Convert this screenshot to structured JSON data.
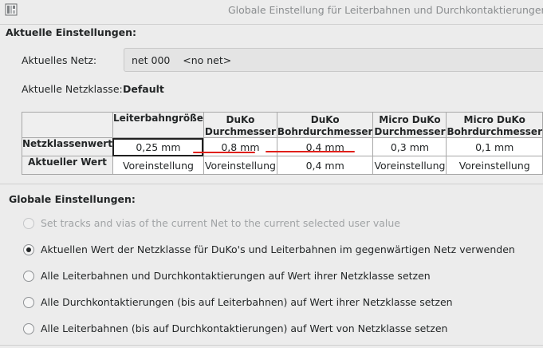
{
  "window": {
    "title": "Globale Einstellung für Leiterbahnen und Durchkontaktierungen",
    "icon": "board-icon"
  },
  "current": {
    "section_title": "Aktuelle Einstellungen:",
    "net_label": "Aktuelles Netz:",
    "net_value": "net 000    <no net>",
    "netclass_label": "Aktuelle Netzklasse:",
    "netclass_value": "Default"
  },
  "table": {
    "columns": [
      {
        "line1": "Leiterbahngröße",
        "line2": ""
      },
      {
        "line1": "DuKo",
        "line2": "Durchmesser"
      },
      {
        "line1": "DuKo",
        "line2": "Bohrdurchmesser"
      },
      {
        "line1": "Micro DuKo",
        "line2": "Durchmesser"
      },
      {
        "line1": "Micro DuKo",
        "line2": "Bohrdurchmesser"
      }
    ],
    "rows": [
      {
        "header": "Netzklassenwert",
        "cells": [
          "0,25 mm",
          "0,8 mm",
          "0,4 mm",
          "0,3 mm",
          "0,1 mm"
        ]
      },
      {
        "header": "Aktueller Wert",
        "cells": [
          "Voreinstellung",
          "Voreinstellung",
          "0,4 mm",
          "Voreinstellung",
          "Voreinstellung"
        ]
      }
    ],
    "selected_cell": "0,25 mm",
    "highlight_color": "#e0201a"
  },
  "global": {
    "section_title": "Globale Einstellungen:",
    "options": [
      {
        "label": "Set tracks and vias of the current Net to the current selected user value",
        "selected": false,
        "enabled": false
      },
      {
        "label": "Aktuellen Wert der Netzklasse für DuKo's und Leiterbahnen im gegenwärtigen Netz verwenden",
        "selected": true,
        "enabled": true
      },
      {
        "label": "Alle Leiterbahnen und Durchkontaktierungen auf Wert ihrer Netzklasse setzen",
        "selected": false,
        "enabled": true
      },
      {
        "label": "Alle Durchkontaktierungen (bis auf Leiterbahnen) auf Wert ihrer Netzklasse setzen",
        "selected": false,
        "enabled": true
      },
      {
        "label": "Alle Leiterbahnen (bis auf Durchkontaktierungen) auf Wert von Netzklasse setzen",
        "selected": false,
        "enabled": true
      }
    ]
  }
}
